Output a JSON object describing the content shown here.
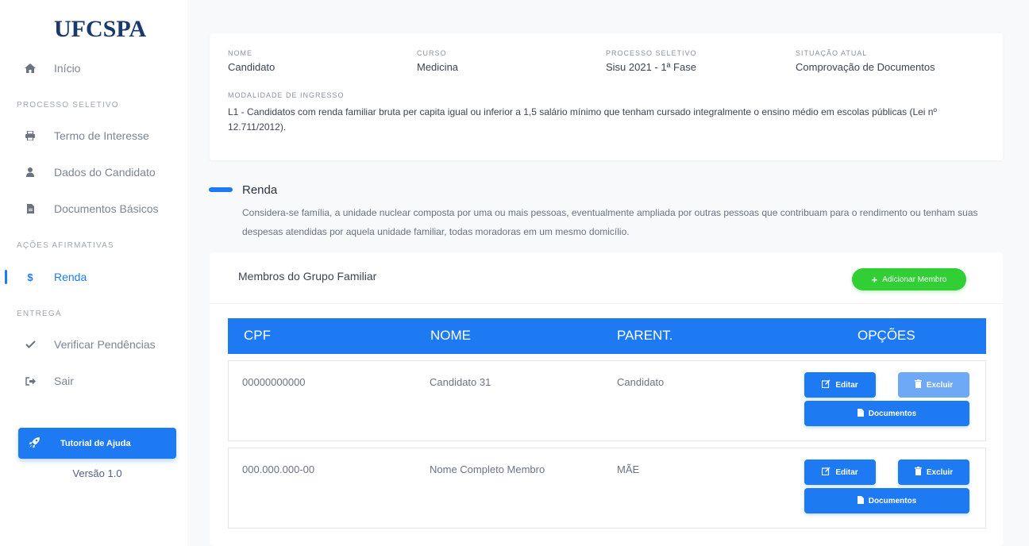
{
  "sidebar": {
    "logo": "UFCSPA",
    "home": {
      "label": "Início",
      "icon": "home-icon"
    },
    "section_processo": "PROCESSO SELETIVO",
    "termo": {
      "label": "Termo de Interesse",
      "icon": "print-icon"
    },
    "dados": {
      "label": "Dados do Candidato",
      "icon": "user-icon"
    },
    "documentos": {
      "label": "Documentos Básicos",
      "icon": "file-icon"
    },
    "section_acoes": "AÇÕES AFIRMATIVAS",
    "renda": {
      "label": "Renda",
      "icon": "dollar-icon"
    },
    "section_entrega": "ENTREGA",
    "verificar": {
      "label": "Verificar Pendências",
      "icon": "check-icon"
    },
    "sair": {
      "label": "Sair",
      "icon": "sign-out-icon"
    },
    "help_button": "Tutorial de Ajuda",
    "version": "Versão 1.0"
  },
  "info": {
    "nome_label": "NOME",
    "nome_value": "Candidato",
    "curso_label": "CURSO",
    "curso_value": "Medicina",
    "processo_label": "PROCESSO SELETIVO",
    "processo_value": "Sisu 2021 - 1ª Fase",
    "situacao_label": "SITUAÇÃO ATUAL",
    "situacao_value": "Comprovação de Documentos",
    "modalidade_label": "MODALIDADE DE INGRESSO",
    "modalidade_value": "L1 - Candidatos com renda familiar bruta per capita igual ou inferior a 1,5 salário mínimo que tenham cursado integralmente o ensino médio em escolas públicas (Lei nº 12.711/2012)."
  },
  "renda": {
    "title": "Renda",
    "description": "Considera-se família, a unidade nuclear composta por uma ou mais pessoas, eventualmente ampliada por outras pessoas que contribuam para o rendimento ou tenham suas despesas atendidas por aquela unidade familiar, todas moradoras em um mesmo domicílio."
  },
  "members": {
    "title": "Membros do Grupo Familiar",
    "add_button": "Adicionar Membro",
    "headers": [
      "CPF",
      "NOME",
      "PARENT.",
      "OPÇÕES"
    ],
    "rows": [
      {
        "cpf": "00000000000",
        "nome": "Candidato 31",
        "parentesco": "Candidato",
        "excluir_disabled": true
      },
      {
        "cpf": "000.000.000-00",
        "nome": "Nome Completo Membro",
        "parentesco": "MÃE",
        "excluir_disabled": false
      }
    ],
    "edit_label": "Editar",
    "delete_label": "Excluir",
    "docs_label": "Documentos"
  },
  "colors": {
    "primary": "#1d7af3",
    "success": "#31ce36",
    "logo": "#1a3a6b"
  }
}
